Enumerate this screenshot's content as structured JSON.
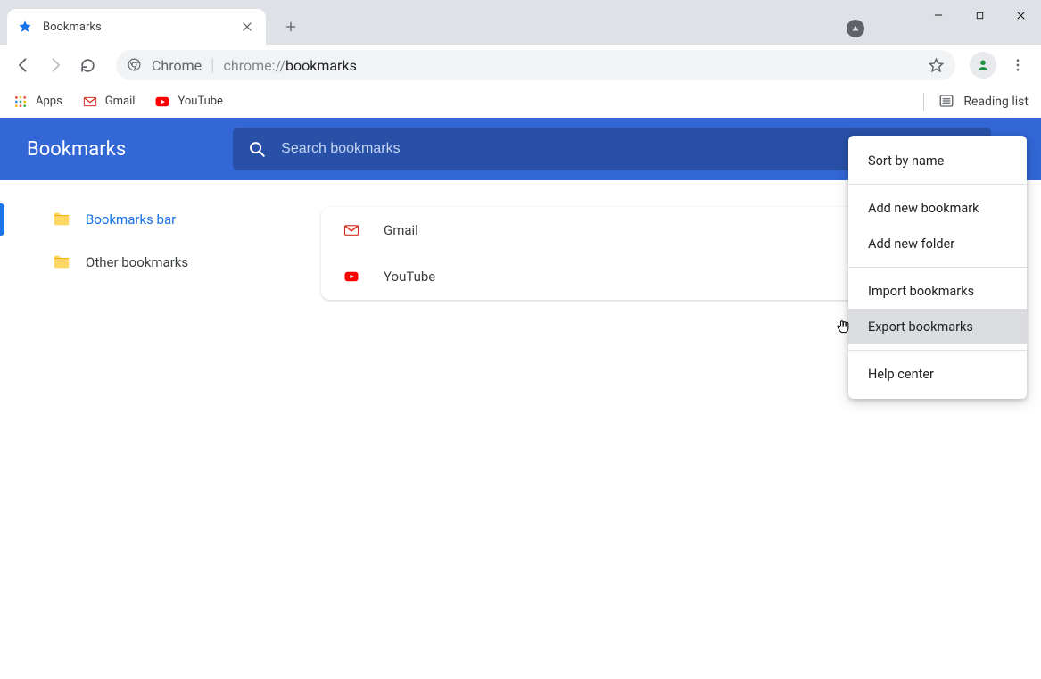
{
  "tab": {
    "title": "Bookmarks"
  },
  "omnibox": {
    "prefix": "Chrome",
    "url_plain": "chrome://",
    "url_bold": "bookmarks"
  },
  "bookmarks_bar": {
    "apps": "Apps",
    "gmail": "Gmail",
    "youtube": "YouTube",
    "reading_list": "Reading list"
  },
  "manager": {
    "title": "Bookmarks",
    "search_placeholder": "Search bookmarks",
    "sidebar": {
      "bookmarks_bar": "Bookmarks bar",
      "other_bookmarks": "Other bookmarks"
    },
    "items": [
      {
        "label": "Gmail",
        "icon": "gmail"
      },
      {
        "label": "YouTube",
        "icon": "youtube"
      }
    ]
  },
  "menu": {
    "sort_by_name": "Sort by name",
    "add_bookmark": "Add new bookmark",
    "add_folder": "Add new folder",
    "import": "Import bookmarks",
    "export": "Export bookmarks",
    "help": "Help center"
  }
}
